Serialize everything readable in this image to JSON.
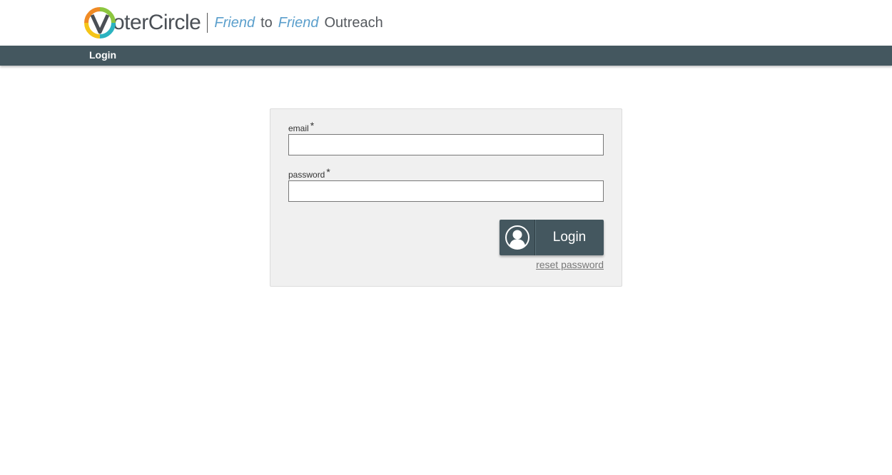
{
  "header": {
    "brand_name": "oterCircle",
    "logo_letter": "V",
    "tagline": {
      "word1": "Friend",
      "word2": "to",
      "word3": "Friend",
      "word4": "Outreach"
    }
  },
  "nav": {
    "items": [
      {
        "label": "Login"
      }
    ]
  },
  "form": {
    "email_label": "email",
    "email_required": "*",
    "email_value": "",
    "password_label": "password",
    "password_required": "*",
    "password_value": "",
    "login_button_label": "Login",
    "login_icon": "user-avatar-icon",
    "reset_link": "reset password"
  },
  "colors": {
    "navbar": "#44575f",
    "card_bg": "#f0f0f0",
    "tagline_accent": "#5b9fcc",
    "logo_yellow": "#f5c518",
    "logo_teal": "#2bb3c0",
    "logo_green": "#8cc63f"
  }
}
